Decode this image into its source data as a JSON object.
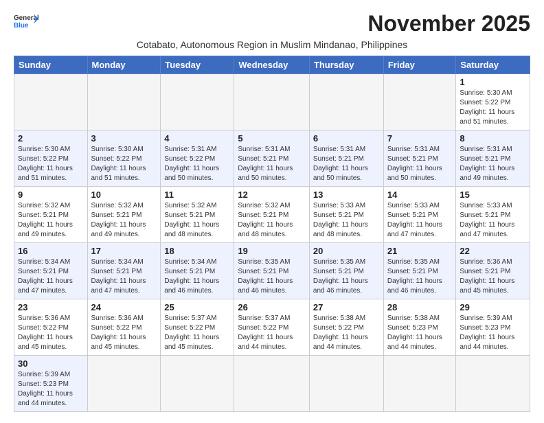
{
  "header": {
    "logo_line1": "General",
    "logo_line2": "Blue",
    "month_title": "November 2025",
    "subtitle": "Cotabato, Autonomous Region in Muslim Mindanao, Philippines"
  },
  "weekdays": [
    "Sunday",
    "Monday",
    "Tuesday",
    "Wednesday",
    "Thursday",
    "Friday",
    "Saturday"
  ],
  "weeks": [
    {
      "days": [
        {
          "num": "",
          "info": ""
        },
        {
          "num": "",
          "info": ""
        },
        {
          "num": "",
          "info": ""
        },
        {
          "num": "",
          "info": ""
        },
        {
          "num": "",
          "info": ""
        },
        {
          "num": "",
          "info": ""
        },
        {
          "num": "1",
          "info": "Sunrise: 5:30 AM\nSunset: 5:22 PM\nDaylight: 11 hours\nand 51 minutes."
        }
      ]
    },
    {
      "days": [
        {
          "num": "2",
          "info": "Sunrise: 5:30 AM\nSunset: 5:22 PM\nDaylight: 11 hours\nand 51 minutes."
        },
        {
          "num": "3",
          "info": "Sunrise: 5:30 AM\nSunset: 5:22 PM\nDaylight: 11 hours\nand 51 minutes."
        },
        {
          "num": "4",
          "info": "Sunrise: 5:31 AM\nSunset: 5:22 PM\nDaylight: 11 hours\nand 50 minutes."
        },
        {
          "num": "5",
          "info": "Sunrise: 5:31 AM\nSunset: 5:21 PM\nDaylight: 11 hours\nand 50 minutes."
        },
        {
          "num": "6",
          "info": "Sunrise: 5:31 AM\nSunset: 5:21 PM\nDaylight: 11 hours\nand 50 minutes."
        },
        {
          "num": "7",
          "info": "Sunrise: 5:31 AM\nSunset: 5:21 PM\nDaylight: 11 hours\nand 50 minutes."
        },
        {
          "num": "8",
          "info": "Sunrise: 5:31 AM\nSunset: 5:21 PM\nDaylight: 11 hours\nand 49 minutes."
        }
      ]
    },
    {
      "days": [
        {
          "num": "9",
          "info": "Sunrise: 5:32 AM\nSunset: 5:21 PM\nDaylight: 11 hours\nand 49 minutes."
        },
        {
          "num": "10",
          "info": "Sunrise: 5:32 AM\nSunset: 5:21 PM\nDaylight: 11 hours\nand 49 minutes."
        },
        {
          "num": "11",
          "info": "Sunrise: 5:32 AM\nSunset: 5:21 PM\nDaylight: 11 hours\nand 48 minutes."
        },
        {
          "num": "12",
          "info": "Sunrise: 5:32 AM\nSunset: 5:21 PM\nDaylight: 11 hours\nand 48 minutes."
        },
        {
          "num": "13",
          "info": "Sunrise: 5:33 AM\nSunset: 5:21 PM\nDaylight: 11 hours\nand 48 minutes."
        },
        {
          "num": "14",
          "info": "Sunrise: 5:33 AM\nSunset: 5:21 PM\nDaylight: 11 hours\nand 47 minutes."
        },
        {
          "num": "15",
          "info": "Sunrise: 5:33 AM\nSunset: 5:21 PM\nDaylight: 11 hours\nand 47 minutes."
        }
      ]
    },
    {
      "days": [
        {
          "num": "16",
          "info": "Sunrise: 5:34 AM\nSunset: 5:21 PM\nDaylight: 11 hours\nand 47 minutes."
        },
        {
          "num": "17",
          "info": "Sunrise: 5:34 AM\nSunset: 5:21 PM\nDaylight: 11 hours\nand 47 minutes."
        },
        {
          "num": "18",
          "info": "Sunrise: 5:34 AM\nSunset: 5:21 PM\nDaylight: 11 hours\nand 46 minutes."
        },
        {
          "num": "19",
          "info": "Sunrise: 5:35 AM\nSunset: 5:21 PM\nDaylight: 11 hours\nand 46 minutes."
        },
        {
          "num": "20",
          "info": "Sunrise: 5:35 AM\nSunset: 5:21 PM\nDaylight: 11 hours\nand 46 minutes."
        },
        {
          "num": "21",
          "info": "Sunrise: 5:35 AM\nSunset: 5:21 PM\nDaylight: 11 hours\nand 46 minutes."
        },
        {
          "num": "22",
          "info": "Sunrise: 5:36 AM\nSunset: 5:21 PM\nDaylight: 11 hours\nand 45 minutes."
        }
      ]
    },
    {
      "days": [
        {
          "num": "23",
          "info": "Sunrise: 5:36 AM\nSunset: 5:22 PM\nDaylight: 11 hours\nand 45 minutes."
        },
        {
          "num": "24",
          "info": "Sunrise: 5:36 AM\nSunset: 5:22 PM\nDaylight: 11 hours\nand 45 minutes."
        },
        {
          "num": "25",
          "info": "Sunrise: 5:37 AM\nSunset: 5:22 PM\nDaylight: 11 hours\nand 45 minutes."
        },
        {
          "num": "26",
          "info": "Sunrise: 5:37 AM\nSunset: 5:22 PM\nDaylight: 11 hours\nand 44 minutes."
        },
        {
          "num": "27",
          "info": "Sunrise: 5:38 AM\nSunset: 5:22 PM\nDaylight: 11 hours\nand 44 minutes."
        },
        {
          "num": "28",
          "info": "Sunrise: 5:38 AM\nSunset: 5:23 PM\nDaylight: 11 hours\nand 44 minutes."
        },
        {
          "num": "29",
          "info": "Sunrise: 5:39 AM\nSunset: 5:23 PM\nDaylight: 11 hours\nand 44 minutes."
        }
      ]
    },
    {
      "days": [
        {
          "num": "30",
          "info": "Sunrise: 5:39 AM\nSunset: 5:23 PM\nDaylight: 11 hours\nand 44 minutes."
        },
        {
          "num": "",
          "info": ""
        },
        {
          "num": "",
          "info": ""
        },
        {
          "num": "",
          "info": ""
        },
        {
          "num": "",
          "info": ""
        },
        {
          "num": "",
          "info": ""
        },
        {
          "num": "",
          "info": ""
        }
      ]
    }
  ]
}
